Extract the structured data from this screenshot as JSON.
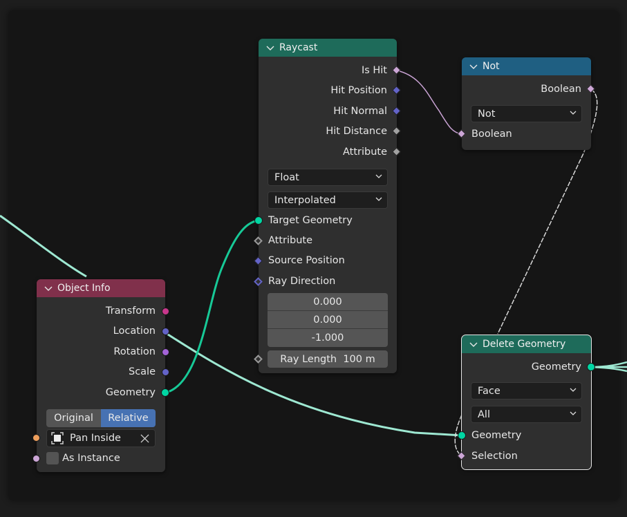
{
  "colors": {
    "raycast_header": "#1e6b5a",
    "not_header": "#1f5f82",
    "object_info_header": "#80304b",
    "delete_geometry_header": "#1e6b5a",
    "geometry_socket": "#00d6a3",
    "boolean_socket": "#cca6d6",
    "vector_socket": "#6363c7",
    "float_socket": "#a1a1a1",
    "matrix_socket": "#c8378b",
    "rotation_socket": "#a363d6",
    "object_socket": "#ed9e5c",
    "relative_active": "#4772b3"
  },
  "nodes": {
    "raycast": {
      "title": "Raycast",
      "outputs": [
        "Is Hit",
        "Hit Position",
        "Hit Normal",
        "Hit Distance",
        "Attribute"
      ],
      "data_type": "Float",
      "mapping": "Interpolated",
      "inputs": [
        "Target Geometry",
        "Attribute",
        "Source Position",
        "Ray Direction"
      ],
      "ray_direction": [
        "0.000",
        "0.000",
        "-1.000"
      ],
      "ray_length_label": "Ray Length",
      "ray_length_value": "100 m"
    },
    "not": {
      "title": "Not",
      "output": "Boolean",
      "operation": "Not",
      "input": "Boolean"
    },
    "object_info": {
      "title": "Object Info",
      "outputs": [
        "Transform",
        "Location",
        "Rotation",
        "Scale",
        "Geometry"
      ],
      "space_options": [
        "Original",
        "Relative"
      ],
      "space_selected": "Relative",
      "object_name": "Pan Inside",
      "as_instance_label": "As Instance",
      "as_instance_checked": false
    },
    "delete_geometry": {
      "title": "Delete Geometry",
      "output": "Geometry",
      "domain": "Face",
      "mode": "All",
      "inputs": [
        "Geometry",
        "Selection"
      ]
    }
  }
}
